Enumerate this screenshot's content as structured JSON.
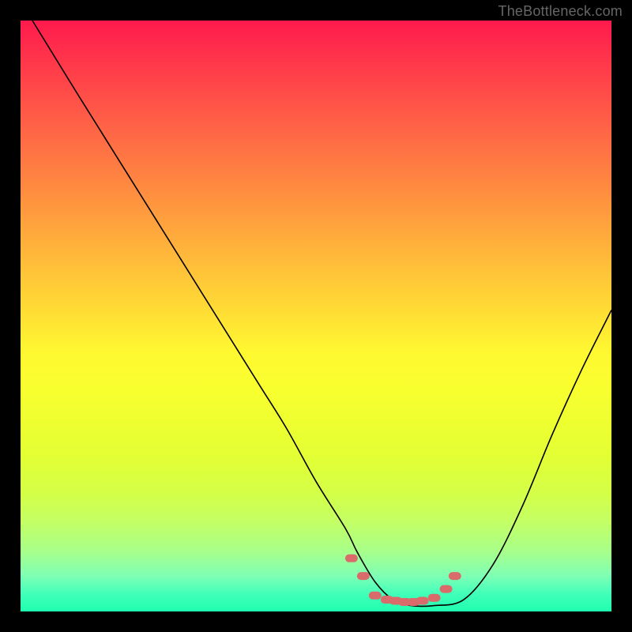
{
  "watermark": "TheBottleneck.com",
  "chart_data": {
    "type": "line",
    "title": "",
    "xlabel": "",
    "ylabel": "",
    "xlim": [
      0,
      100
    ],
    "ylim": [
      0,
      100
    ],
    "x": [
      2,
      10,
      20,
      30,
      40,
      45,
      50,
      55,
      57,
      60,
      63,
      66,
      70,
      75,
      80,
      85,
      90,
      95,
      100
    ],
    "values": [
      100,
      87,
      71,
      55,
      39,
      31,
      22,
      14,
      10,
      5,
      2,
      1,
      1,
      2,
      8,
      18,
      30,
      41,
      51
    ],
    "series": [
      {
        "name": "curve",
        "color": "#000000"
      }
    ],
    "markers": {
      "color": "#d96b6b",
      "shape": "rounded",
      "x": [
        56,
        58,
        60,
        62,
        63.5,
        65,
        66.5,
        68,
        70,
        72,
        73.5
      ],
      "y": [
        9,
        6,
        2.7,
        2,
        1.8,
        1.6,
        1.6,
        1.8,
        2.3,
        3.8,
        6
      ]
    }
  }
}
